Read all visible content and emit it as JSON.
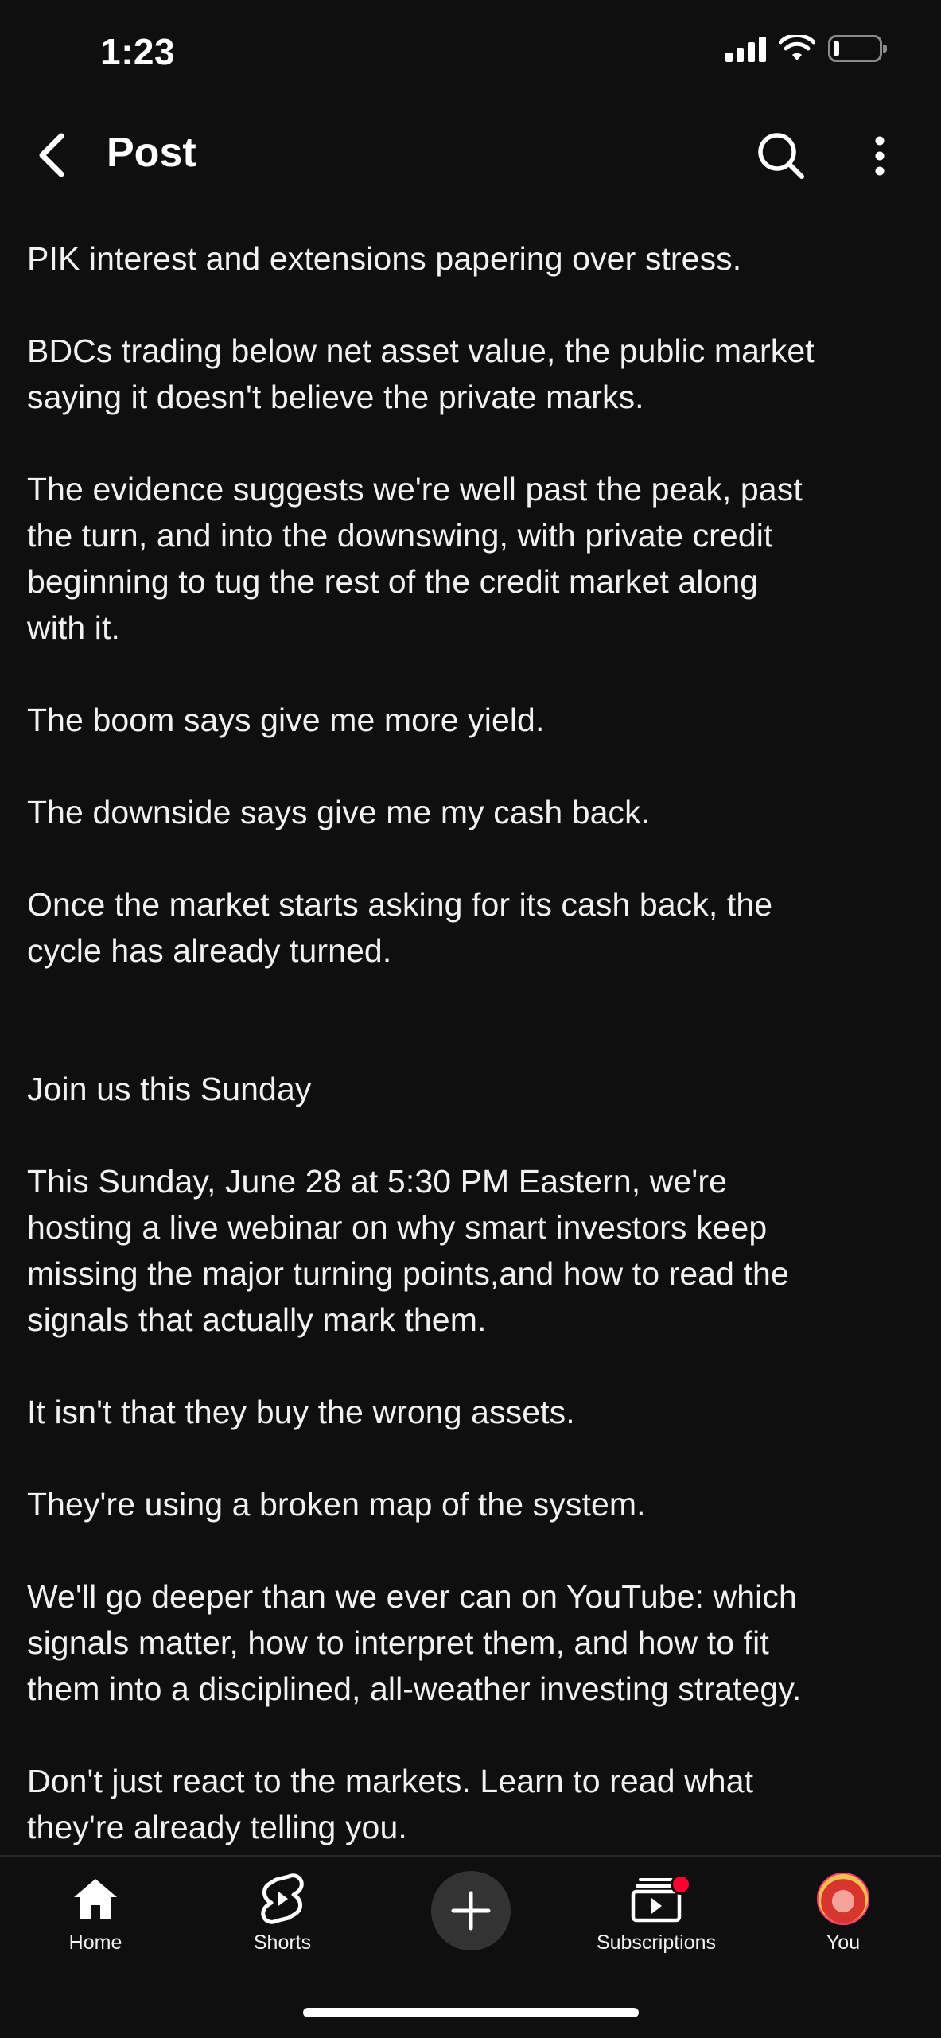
{
  "status_bar": {
    "time": "1:23",
    "battery_level": 0.12
  },
  "header": {
    "title": "Post",
    "back_icon": "chevron-left-icon",
    "search_icon": "search-icon",
    "more_icon": "more-vertical-icon"
  },
  "post": {
    "paragraphs": [
      "PIK interest and extensions papering over stress.",
      "BDCs trading below net asset value, the public market\nsaying it doesn't believe the private marks.",
      "The evidence suggests we're well past the peak, past\nthe turn, and into the downswing, with private credit\nbeginning to tug the rest of the credit market along\nwith it.",
      "The boom says give me more yield.",
      "The downside says give me my cash back.",
      "Once the market starts asking for its cash back, the\ncycle has already turned.",
      "Join us this Sunday",
      "This Sunday, June 28 at 5:30 PM Eastern, we're\nhosting a live webinar on why smart investors keep\nmissing the major turning points,and how to read the\nsignals that actually mark them.",
      "It isn't that they buy the wrong assets.",
      "They're using a broken map of the system.",
      "We'll go deeper than we ever can on YouTube: which\nsignals matter, how to interpret them, and how to fit\nthem into a disciplined, all-weather investing strategy.",
      "Don't just react to the markets. Learn to read what\nthey're already telling you."
    ]
  },
  "bottom_nav": {
    "home": "Home",
    "shorts": "Shorts",
    "subscriptions": "Subscriptions",
    "you": "You"
  },
  "colors": {
    "background": "#0f0f0f",
    "text": "#f1f1f1",
    "notification_dot": "#ff0033"
  }
}
